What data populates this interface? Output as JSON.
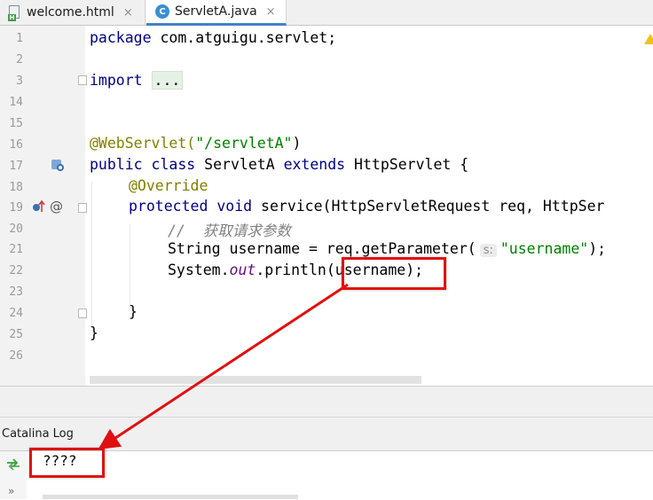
{
  "tabs": [
    {
      "label": "welcome.html",
      "icon": "html-file-icon",
      "icon_letter": "H",
      "close": "×"
    },
    {
      "label": "ServletA.java",
      "icon": "java-class-icon",
      "icon_letter": "C",
      "close": "×",
      "active": true
    }
  ],
  "editor": {
    "line_numbers": [
      "1",
      "2",
      "3",
      "14",
      "15",
      "16",
      "17",
      "18",
      "19",
      "20",
      "21",
      "22",
      "23",
      "24",
      "25",
      "26"
    ],
    "lines": {
      "l1_kw": "package",
      "l1_rest": " com.atguigu.servlet;",
      "l3_kw": "import",
      "l3_fold": "...",
      "l16_ann": "@WebServlet(",
      "l16_str": "\"/servletA\"",
      "l16_close": ")",
      "l17_kw1": "public class",
      "l17_name": " ServletA ",
      "l17_kw2": "extends",
      "l17_rest": " HttpServlet {",
      "l18_ann": "@Override",
      "l19_kw": "protected void",
      "l19_rest": " service(HttpServletRequest req, HttpSer",
      "l20_cmt": "//  获取请求参数",
      "l21_a": "String username = req.getParameter(",
      "l21_hint": "s:",
      "l21_str": "\"username\"",
      "l21_end": ");",
      "l22_a": "System.",
      "l22_fld": "out",
      "l22_b": ".println(username)",
      "l22_end": ";",
      "l24": "}",
      "l25": "}"
    }
  },
  "log": {
    "title": "Catalina Log",
    "output": "????",
    "more": "»"
  },
  "annotation_color": "#e01010"
}
